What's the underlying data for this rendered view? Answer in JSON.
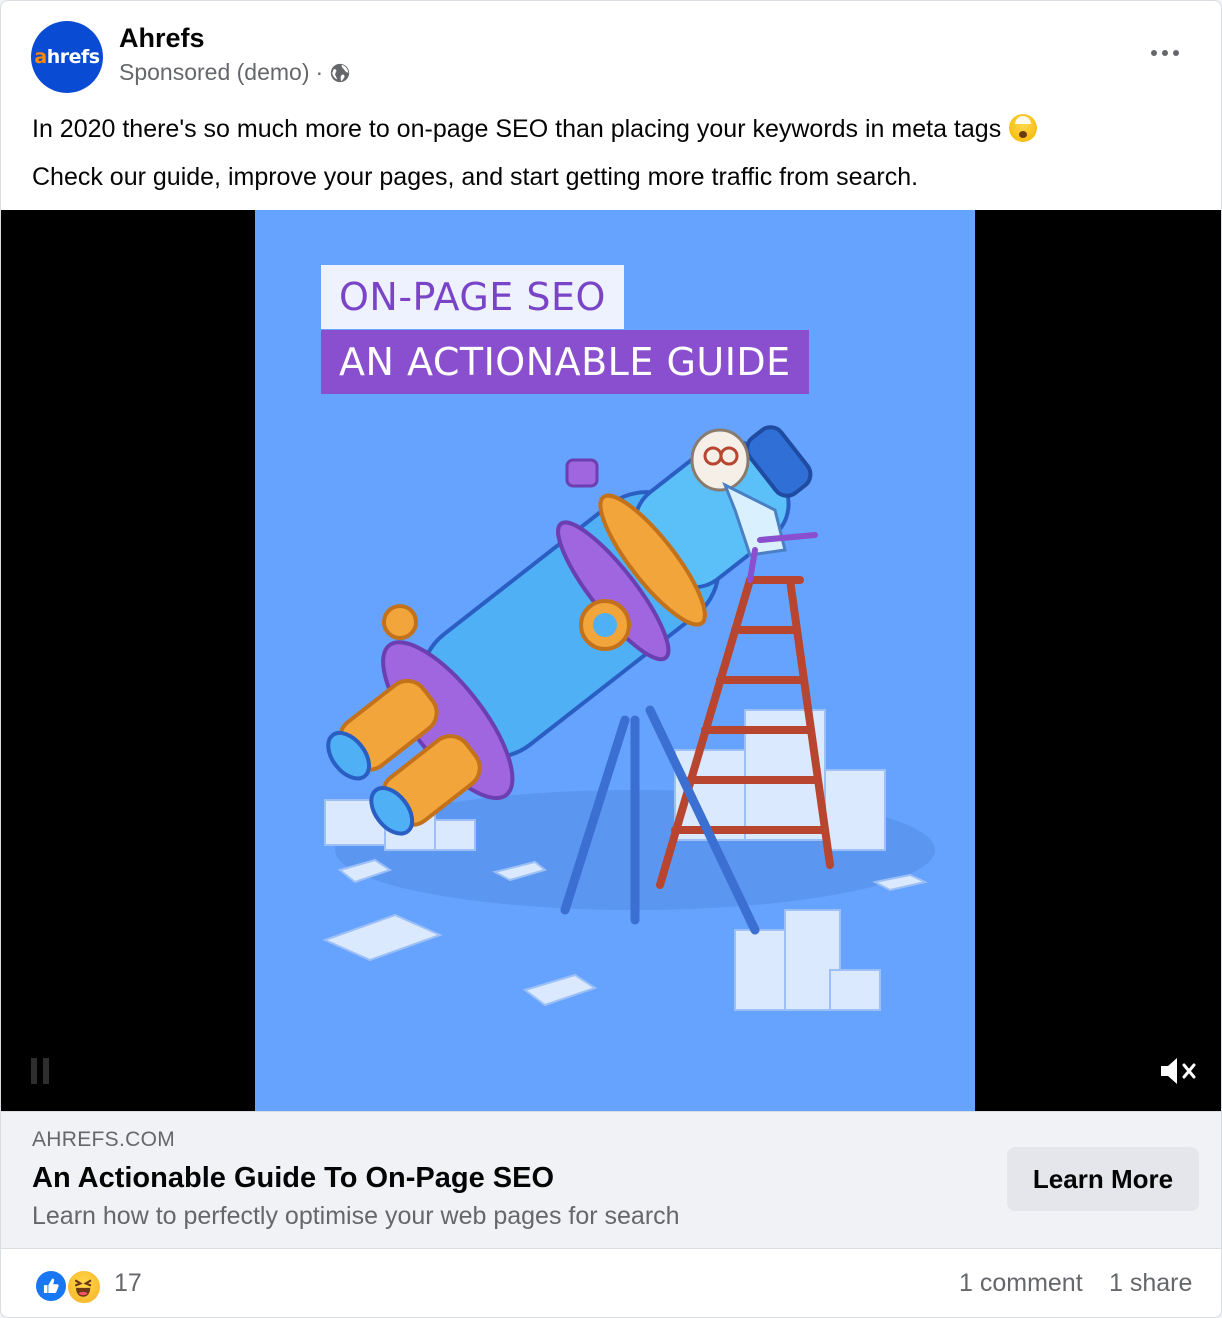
{
  "post": {
    "page_name": "Ahrefs",
    "avatar_text_accent": "a",
    "avatar_text_rest": "hrefs",
    "sponsored_label": "Sponsored (demo)",
    "meta_separator": "·",
    "audience_icon": "globe-icon",
    "more_icon": "more-horizontal-icon",
    "caption_line_1": "In 2020 there's so much more to on-page SEO than placing your keywords in meta tags",
    "caption_emoji": "exploding-head-emoji",
    "caption_line_2": "Check our guide, improve your pages, and start getting more traffic from search."
  },
  "media": {
    "type": "video",
    "poster_title_line_1": "ON-PAGE SEO",
    "poster_title_line_2": "AN ACTIONABLE GUIDE",
    "illustration": "scientist on ladder looking into giant telescope among paper stacks",
    "sound_icon": "muted-speaker-icon",
    "playback_icon": "pause-icon"
  },
  "link_preview": {
    "domain": "AHREFS.COM",
    "title": "An Actionable Guide To On-Page SEO",
    "description": "Learn how to perfectly optimise your web pages for search",
    "cta_label": "Learn More"
  },
  "engagement": {
    "reaction_icons": [
      "like-icon",
      "haha-icon"
    ],
    "reaction_count": "17",
    "comments": "1 comment",
    "shares": "1 share"
  },
  "colors": {
    "brand_blue": "#0a4bd4",
    "brand_orange": "#ff8a00",
    "poster_bg": "#66a3ff",
    "poster_purple": "#8a4fcf",
    "like_blue": "#1877f2"
  }
}
